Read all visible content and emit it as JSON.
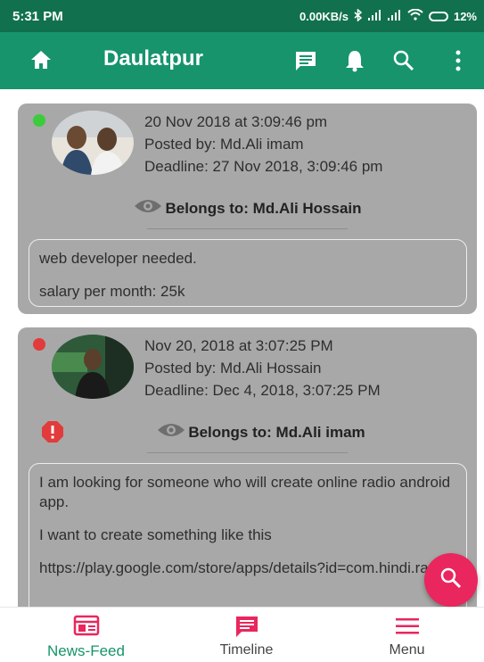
{
  "status_bar": {
    "time": "5:31 PM",
    "speed": "0.00KB/s",
    "battery": "12%",
    "icons": [
      "bluetooth-icon",
      "signal-icon",
      "signal-icon",
      "wifi-icon",
      "battery-icon"
    ]
  },
  "app_bar": {
    "title": "Daulatpur",
    "icons": [
      "home-icon",
      "message-icon",
      "bell-icon",
      "search-icon",
      "more-vert-icon"
    ],
    "color": "#17946b"
  },
  "posts": [
    {
      "status_color": "#3bcc3b",
      "date": "20 Nov 2018 at 3:09:46 pm",
      "posted_by": "Posted by: Md.Ali imam",
      "deadline": "Deadline: 27 Nov 2018, 3:09:46 pm",
      "belongs": "Belongs to: Md.Ali Hossain",
      "body": [
        "web developer needed.",
        "salary per month: 25k"
      ]
    },
    {
      "status_color": "#e23b3b",
      "date": "Nov 20, 2018 at 3:07:25 PM",
      "posted_by": "Posted by: Md.Ali Hossain",
      "deadline": "Deadline: Dec 4, 2018, 3:07:25 PM",
      "belongs": "Belongs to: Md.Ali imam",
      "body": [
        "I am looking for someone who will create online radio android app.",
        "I want to create something like this",
        "https://play.google.com/store/apps/details?id=com.hindi.radios"
      ]
    }
  ],
  "fab": {
    "icon": "search-icon",
    "color": "#e9265d"
  },
  "bottom_nav": {
    "items": [
      {
        "label": "News-Feed",
        "icon": "newspaper-icon",
        "active": true
      },
      {
        "label": "Timeline",
        "icon": "message-icon",
        "active": false
      },
      {
        "label": "Menu",
        "icon": "menu-icon",
        "active": false
      }
    ]
  }
}
